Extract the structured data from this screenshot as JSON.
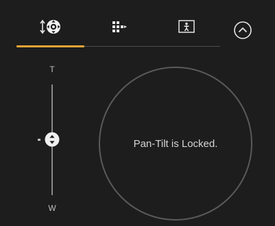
{
  "tabs": [
    {
      "icon": "pan-tilt-target-icon",
      "active": true
    },
    {
      "icon": "preset-grid-icon",
      "active": false
    },
    {
      "icon": "person-frame-icon",
      "active": false
    }
  ],
  "collapse": {
    "icon": "chevron-up-circle-icon"
  },
  "zoom": {
    "tele_label": "T",
    "wide_label": "W",
    "position": 0.5
  },
  "pan_tilt": {
    "status_text": "Pan-Tilt is Locked."
  },
  "colors": {
    "accent": "#e8a436",
    "background": "#1d1d1d",
    "ring": "#5a5a5a"
  }
}
